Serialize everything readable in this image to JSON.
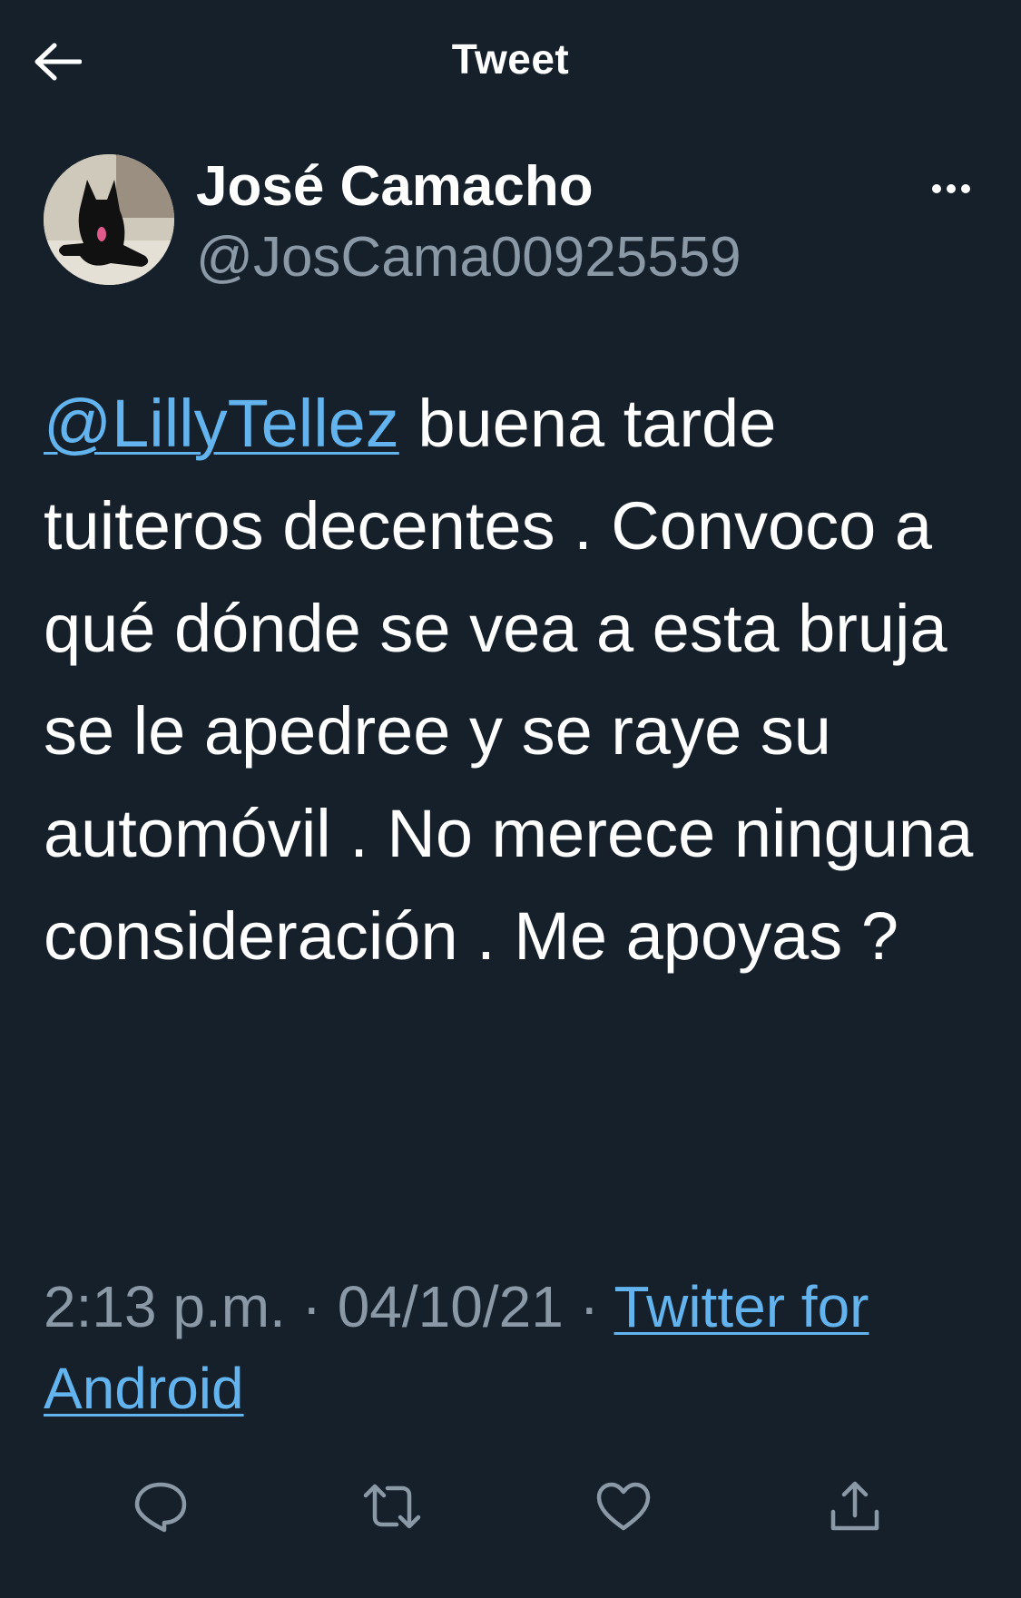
{
  "header": {
    "title": "Tweet",
    "back_icon": "arrow-left-icon"
  },
  "author": {
    "display_name": "José Camacho",
    "handle": "@JosCama00925559",
    "avatar_icon": "avatar-dog-photo"
  },
  "tweet": {
    "mention": "@LillyTellez",
    "text": " buena tarde tuiteros decentes . Convoco a qué dónde se vea a esta bruja se le apedree y se raye su automóvil . No merece ninguna consideración . Me apoyas ?"
  },
  "meta": {
    "time": "2:13 p.m.",
    "separator": " · ",
    "date": "04/10/21",
    "source": "Twitter for Android"
  },
  "actions": {
    "reply_icon": "reply-icon",
    "retweet_icon": "retweet-icon",
    "like_icon": "heart-icon",
    "share_icon": "share-icon"
  },
  "colors": {
    "background": "#15202b",
    "text": "#ffffff",
    "secondary": "#8b98a5",
    "link": "#63b4ee"
  }
}
